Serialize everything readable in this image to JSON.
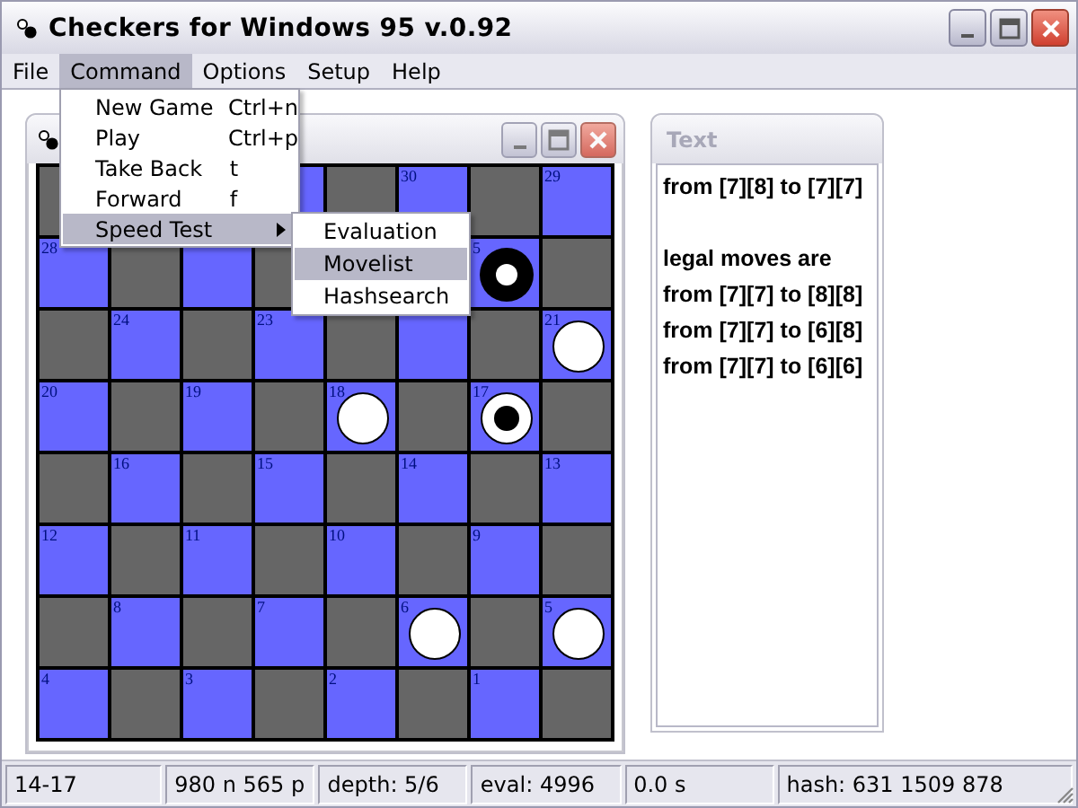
{
  "window": {
    "title": "Checkers for Windows 95 v.0.92"
  },
  "menu_bar": [
    {
      "label": "File",
      "selected": false
    },
    {
      "label": "Command",
      "selected": true
    },
    {
      "label": "Options",
      "selected": false
    },
    {
      "label": "Setup",
      "selected": false
    },
    {
      "label": "Help",
      "selected": false
    }
  ],
  "command_menu": [
    {
      "label": "New Game",
      "shortcut": "Ctrl+n",
      "has_submenu": false,
      "selected": false
    },
    {
      "label": "Play",
      "shortcut": "Ctrl+p",
      "has_submenu": false,
      "selected": false
    },
    {
      "label": "Take Back",
      "shortcut": "t",
      "has_submenu": false,
      "selected": false
    },
    {
      "label": "Forward",
      "shortcut": "f",
      "has_submenu": false,
      "selected": false
    },
    {
      "label": "Speed Test",
      "has_submenu": true,
      "selected": true
    }
  ],
  "speed_test_submenu": [
    {
      "label": "Evaluation",
      "selected": false
    },
    {
      "label": "Movelist",
      "selected": true
    },
    {
      "label": "Hashsearch",
      "selected": false
    }
  ],
  "board": {
    "rows": [
      [
        {},
        {},
        {
          "label": "30"
        },
        {
          "label": "29"
        }
      ],
      [
        {
          "label": "28"
        },
        {},
        {},
        {
          "label": "5",
          "kind": "black_ringed"
        }
      ],
      [
        {
          "label": "24"
        },
        {
          "label": "23"
        },
        {},
        {
          "label": "21",
          "kind": "white"
        }
      ],
      [
        {
          "label": "20"
        },
        {
          "label": "19"
        },
        {
          "label": "18",
          "kind": "white"
        },
        {
          "label": "17",
          "kind": "white_dotted"
        }
      ],
      [
        {
          "label": "16"
        },
        {
          "label": "15"
        },
        {
          "label": "14"
        },
        {
          "label": "13"
        }
      ],
      [
        {
          "label": "12"
        },
        {
          "label": "11"
        },
        {
          "label": "10"
        },
        {
          "label": "9"
        }
      ],
      [
        {
          "label": "8"
        },
        {
          "label": "7"
        },
        {
          "label": "6",
          "kind": "white"
        },
        {
          "label": "5",
          "kind": "white"
        }
      ],
      [
        {
          "label": "4"
        },
        {
          "label": "3"
        },
        {
          "label": "2"
        },
        {
          "label": "1"
        }
      ]
    ]
  },
  "text_window": {
    "title": "Text",
    "lines": [
      {
        "text": "from [7][8] to [7][7]",
        "blank_before": false
      },
      {
        "text": "legal moves are",
        "blank_before": true
      },
      {
        "text": "from [7][7] to [8][8]",
        "blank_before": false
      },
      {
        "text": "from [7][7] to [6][8]",
        "blank_before": false
      },
      {
        "text": "from [7][7] to [6][6]",
        "blank_before": false
      }
    ]
  },
  "status_bar": [
    "14-17",
    "980 n 565 p",
    "depth: 5/6",
    "eval: 4996",
    "0.0 s",
    "hash: 631 1509 878"
  ]
}
